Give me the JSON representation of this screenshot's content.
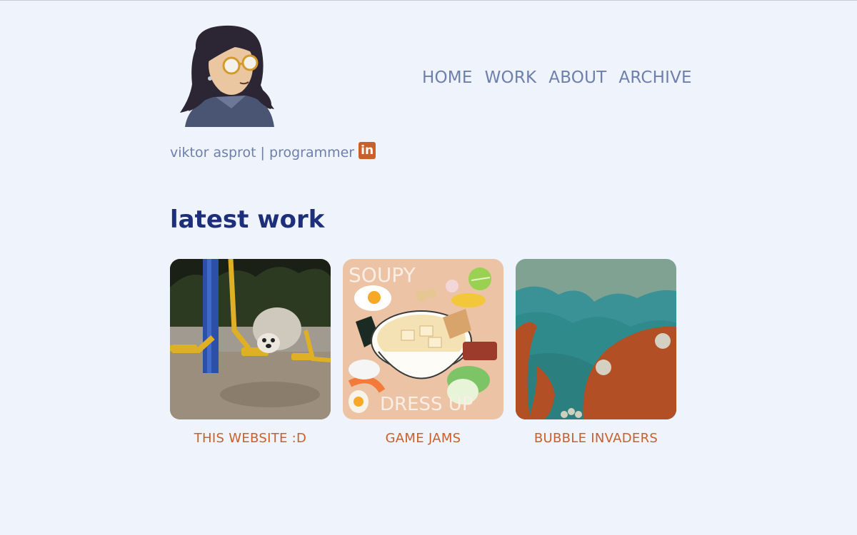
{
  "header": {
    "nav": [
      {
        "label": "HOME"
      },
      {
        "label": "WORK"
      },
      {
        "label": "ABOUT"
      },
      {
        "label": "ARCHIVE"
      }
    ],
    "tagline": "viktor asprot | programmer",
    "linkedin_icon": "in"
  },
  "main": {
    "section_title": "latest work",
    "cards": [
      {
        "label": "THIS WEBSITE :D",
        "image": "fluffy-dog-on-swing"
      },
      {
        "label": "GAME JAMS",
        "image": "soupy-dress-up-cover",
        "image_text_top": "SOUPY",
        "image_text_bottom": "DRESS UP"
      },
      {
        "label": "BUBBLE INVADERS",
        "image": "bubble-invaders-art"
      }
    ]
  },
  "colors": {
    "background": "#eff3fb",
    "nav": "#6d7fad",
    "title": "#1d2f7a",
    "accent": "#c9602a"
  }
}
